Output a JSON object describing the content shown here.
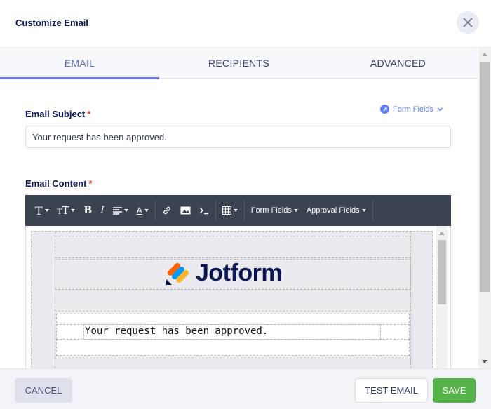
{
  "modal": {
    "title": "Customize Email"
  },
  "tabs": [
    {
      "label": "EMAIL",
      "active": true
    },
    {
      "label": "RECIPIENTS",
      "active": false
    },
    {
      "label": "ADVANCED",
      "active": false
    }
  ],
  "subject": {
    "label": "Email Subject",
    "required_mark": "*",
    "value": "Your request has been approved.",
    "form_fields_link": "Form Fields"
  },
  "content": {
    "label": "Email Content",
    "required_mark": "*",
    "toolbar": {
      "form_fields_menu": "Form Fields",
      "approval_fields_menu": "Approval Fields",
      "icons": [
        "text-style-icon",
        "font-size-icon",
        "bold-icon",
        "italic-icon",
        "align-icon",
        "font-color-icon",
        "link-icon",
        "image-icon",
        "code-icon",
        "table-icon"
      ]
    },
    "body_text": "Your request has been approved.",
    "logo_text": "Jotform"
  },
  "footer": {
    "cancel_label": "CANCEL",
    "test_email_label": "TEST EMAIL",
    "save_label": "SAVE"
  },
  "colors": {
    "accent": "#6f76d9",
    "save": "#56b34a",
    "toolbar": "#3b4250",
    "brand_navy": "#0a1551"
  }
}
